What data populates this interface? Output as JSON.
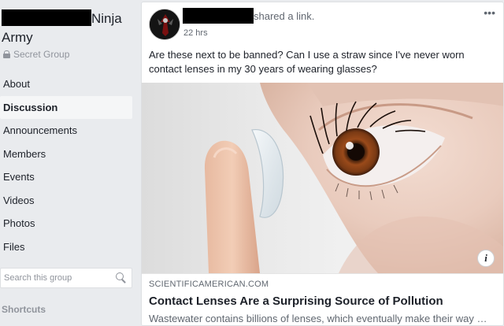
{
  "sidebar": {
    "group_name_suffix": "Ninja",
    "group_name_line2": "Army",
    "privacy_label": "Secret Group",
    "nav_items": [
      {
        "label": "About"
      },
      {
        "label": "Discussion"
      },
      {
        "label": "Announcements"
      },
      {
        "label": "Members"
      },
      {
        "label": "Events"
      },
      {
        "label": "Videos"
      },
      {
        "label": "Photos"
      },
      {
        "label": "Files"
      }
    ],
    "active_item": "Discussion",
    "search_placeholder": "Search this group",
    "shortcuts_label": "Shortcuts"
  },
  "post": {
    "action_text": "shared a link.",
    "timestamp": "22 hrs",
    "more_label": "•••",
    "body": "Are these next to be banned? Can I use a straw since I've never worn contact lenses in my 30 years of wearing glasses?",
    "link": {
      "domain": "SCIENTIFICAMERICAN.COM",
      "title": "Contact Lenses Are a Surprising Source of Pollution",
      "description": "Wastewater contains billions of lenses, which eventually make their way in…",
      "info_label": "i"
    }
  },
  "colors": {
    "page_bg": "#e9ebee",
    "card_bg": "#ffffff",
    "text_primary": "#1d2129",
    "text_secondary": "#606770",
    "redaction": "#000000"
  }
}
